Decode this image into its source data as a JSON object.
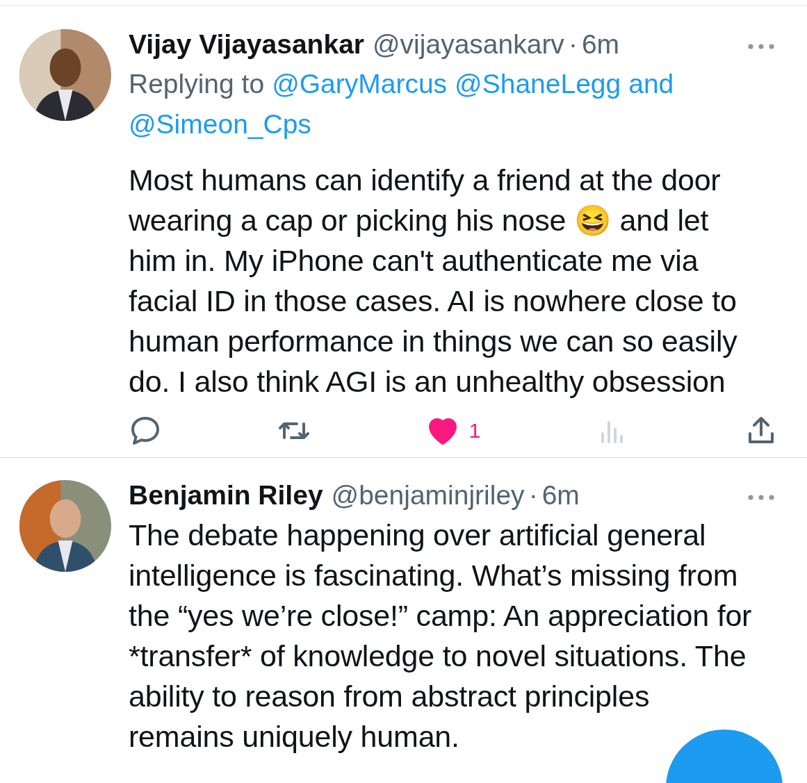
{
  "tweets": [
    {
      "name": "Vijay Vijayasankar",
      "handle": "@vijayasankarv",
      "time": "6m",
      "separator": "·",
      "replying_to": {
        "label": "Replying to",
        "mentions": [
          "@GaryMarcus",
          "@ShaneLegg"
        ],
        "joiner": "and",
        "last": "@Simeon_Cps"
      },
      "text": "Most humans can identify a friend at the door wearing a cap or picking his nose 😆 and let him in. My iPhone can't authenticate me via facial ID in those cases. AI is nowhere close to human performance in things we can so easily do. I also think AGI is an unhealthy obsession",
      "actions": {
        "liked": true,
        "like_count": "1"
      }
    },
    {
      "name": "Benjamin Riley",
      "handle": "@benjaminjriley",
      "time": "6m",
      "separator": "·",
      "text": "The debate happening over artificial general intelligence is fascinating. What’s missing from the “yes we’re close!” camp: An appreciation for *transfer* of knowledge to novel situations. The ability to reason from abstract principles remains uniquely human."
    }
  ]
}
